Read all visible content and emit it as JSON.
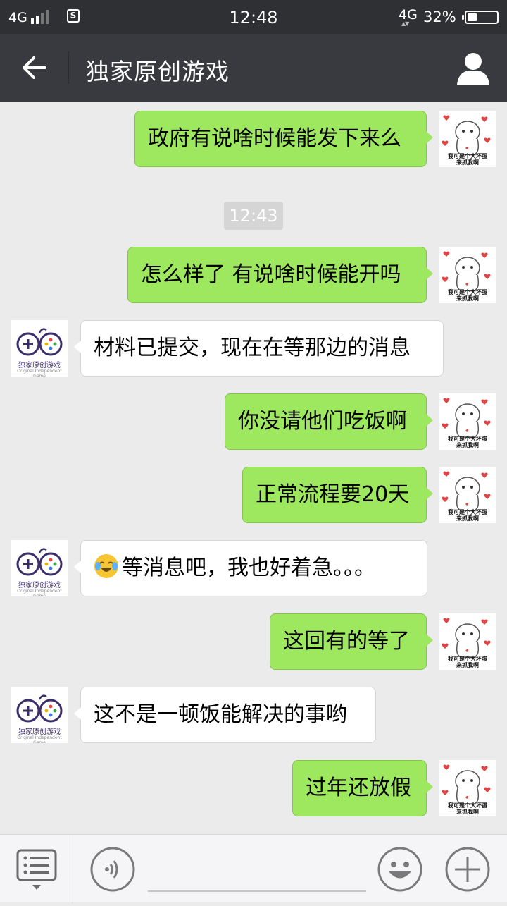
{
  "status_bar": {
    "network": "4G",
    "sim_icon": "S",
    "time": "12:48",
    "network_right": "4G",
    "battery_percent": "32%",
    "battery_level": 0.32
  },
  "header": {
    "title": "独家原创游戏",
    "back_icon": "arrow-left",
    "profile_icon": "person"
  },
  "avatars": {
    "me_caption_line1": "我可是个大坏蛋",
    "me_caption_line2": "来抓我啊",
    "other_logo_text": "独家原创游戏",
    "other_logo_sub": "Original Independent Game"
  },
  "timestamp": "12:43",
  "messages": [
    {
      "from": "me",
      "text": "政府有说啥时候能发下来么"
    },
    {
      "from": "me",
      "text": "怎么样了 有说啥时候能开吗"
    },
    {
      "from": "other",
      "text": "材料已提交，现在在等那边的消息"
    },
    {
      "from": "me",
      "text": "你没请他们吃饭啊"
    },
    {
      "from": "me",
      "text": "正常流程要20天"
    },
    {
      "from": "other",
      "text": "等消息吧，我也好着急。。。",
      "emoji": "crying-laughing"
    },
    {
      "from": "me",
      "text": "这回有的等了"
    },
    {
      "from": "other",
      "text": "这不是一顿饭能解决的事哟"
    },
    {
      "from": "me",
      "text": "过年还放假"
    }
  ],
  "colors": {
    "outgoing_bubble": "#9de85e",
    "incoming_bubble": "#ffffff",
    "header_bg": "#393a3f",
    "statusbar_bg": "#2f3033",
    "chat_bg": "#ebebeb"
  }
}
